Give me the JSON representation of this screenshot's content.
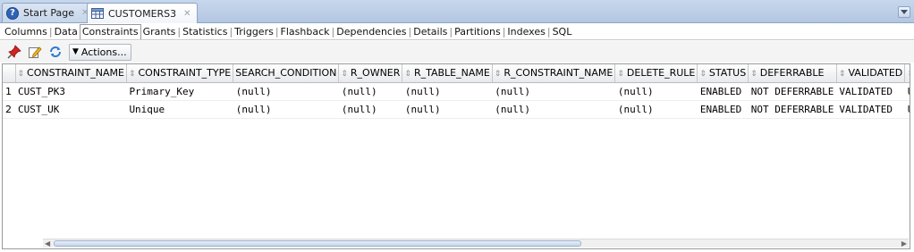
{
  "doc_tabs": [
    {
      "label": "Start Page",
      "icon": "help-icon",
      "active": false
    },
    {
      "label": "CUSTOMERS3",
      "icon": "table-icon",
      "active": true
    }
  ],
  "sub_tabs": [
    "Columns",
    "Data",
    "Constraints",
    "Grants",
    "Statistics",
    "Triggers",
    "Flashback",
    "Dependencies",
    "Details",
    "Partitions",
    "Indexes",
    "SQL"
  ],
  "active_sub_tab": "Constraints",
  "toolbar": {
    "pin_icon": "pin-icon",
    "edit_icon": "edit-icon",
    "refresh_icon": "refresh-icon",
    "actions_label": "Actions..."
  },
  "grid": {
    "columns": [
      "CONSTRAINT_NAME",
      "CONSTRAINT_TYPE",
      "SEARCH_CONDITION",
      "R_OWNER",
      "R_TABLE_NAME",
      "R_CONSTRAINT_NAME",
      "DELETE_RULE",
      "STATUS",
      "DEFERRABLE",
      "VALIDATED"
    ],
    "rows": [
      {
        "num": "1",
        "cells": [
          "CUST_PK3",
          "Primary_Key",
          "(null)",
          "(null)",
          "(null)",
          "(null)",
          "(null)",
          "ENABLED",
          "NOT DEFERRABLE",
          "VALIDATED"
        ],
        "overflow": "U"
      },
      {
        "num": "2",
        "cells": [
          "CUST_UK",
          "Unique",
          "(null)",
          "(null)",
          "(null)",
          "(null)",
          "(null)",
          "ENABLED",
          "NOT DEFERRABLE",
          "VALIDATED"
        ],
        "overflow": "U"
      }
    ]
  }
}
